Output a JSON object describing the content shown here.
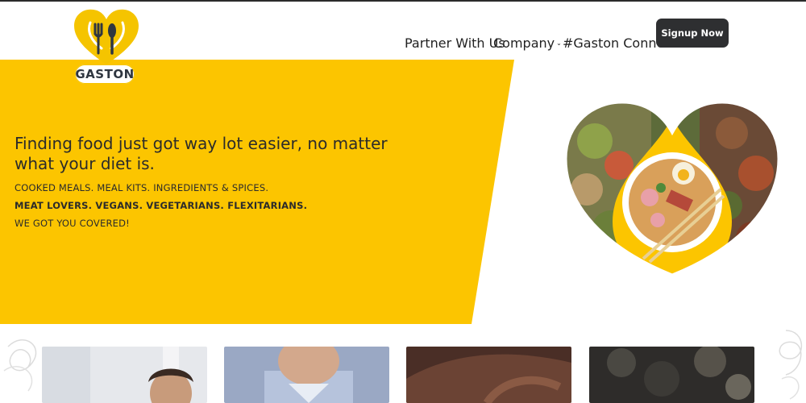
{
  "brand": {
    "name": "GASTON",
    "color": "#f5c400",
    "dark": "#2e2f31"
  },
  "nav": {
    "partner": "Partner With Us",
    "company": "Company",
    "connect": "#Gaston Connect",
    "signup": "Signup Now"
  },
  "hero": {
    "headline_line1": "Finding food just got way lot easier, no matter",
    "headline_line2": "what your diet is.",
    "line1": "COOKED MEALS. MEAL KITS. INGREDIENTS & SPICES.",
    "line2": "MEAT LOVERS. VEGANS. VEGETARIANS. FLEXITARIANS.",
    "line3": "WE GOT YOU COVERED!"
  },
  "icons": {
    "logo": "fork-knife-logo-icon",
    "chevron": "chevron-down-icon"
  }
}
